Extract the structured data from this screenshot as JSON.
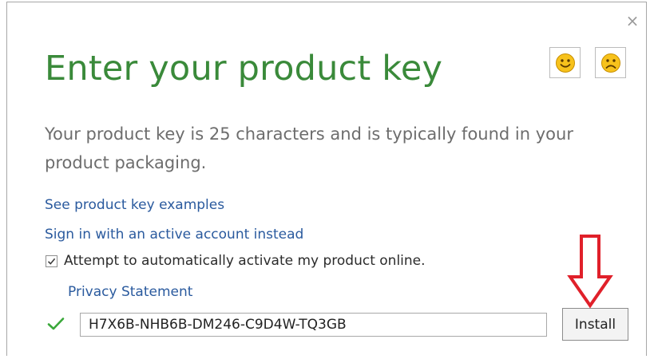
{
  "dialog": {
    "close_glyph": "×",
    "title": "Enter your product key",
    "description": "Your product key is 25 characters and is typically found in your product packaging.",
    "links": {
      "examples": "See product key examples",
      "signin": "Sign in with an active account instead",
      "privacy": "Privacy Statement"
    },
    "auto_activate": {
      "label": "Attempt to automatically activate my product online.",
      "checked": true
    },
    "product_key": {
      "value": "H7X6B-NHB6B-DM246-C9D4W-TQ3GB",
      "valid": true
    },
    "install_label": "Install",
    "feedback_icons": [
      "smile-icon",
      "frown-icon"
    ],
    "annotation": "down-arrow-icon",
    "colors": {
      "title": "#3a8a3a",
      "link": "#2a5a9e",
      "check": "#3aa83a",
      "annotation_arrow": "#e0202a"
    }
  }
}
